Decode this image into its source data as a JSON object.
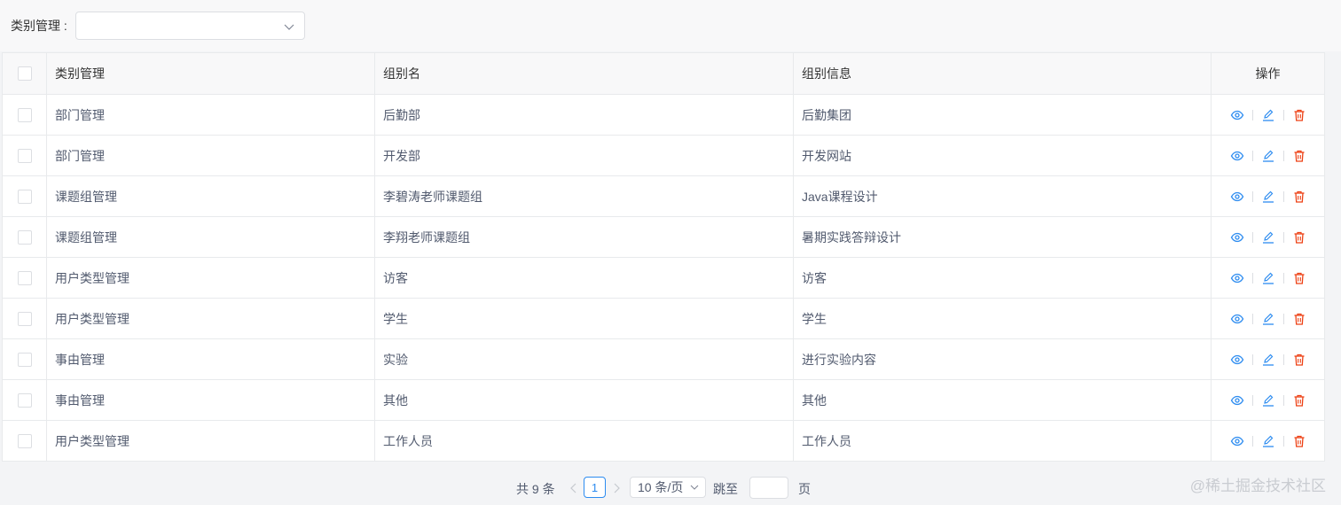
{
  "filter": {
    "label": "类别管理 :",
    "select_value": ""
  },
  "table": {
    "columns": [
      "类别管理",
      "组别名",
      "组别信息",
      "操作"
    ],
    "rows": [
      [
        "部门管理",
        "后勤部",
        "后勤集团"
      ],
      [
        "部门管理",
        "开发部",
        "开发网站"
      ],
      [
        "课题组管理",
        "李碧涛老师课题组",
        "Java课程设计"
      ],
      [
        "课题组管理",
        "李翔老师课题组",
        "暑期实践答辩设计"
      ],
      [
        "用户类型管理",
        "访客",
        "访客"
      ],
      [
        "用户类型管理",
        "学生",
        "学生"
      ],
      [
        "事由管理",
        "实验",
        "进行实验内容"
      ],
      [
        "事由管理",
        "其他",
        "其他"
      ],
      [
        "用户类型管理",
        "工作人员",
        "工作人员"
      ]
    ],
    "row_actions": [
      "eye-icon",
      "edit-icon",
      "trash-icon"
    ]
  },
  "pagination": {
    "total": "共 9 条",
    "current_page": "1",
    "page_size": "10 条/页",
    "jump_label": "跳至",
    "jump_value": "",
    "page_label": "页"
  },
  "watermark": "@稀土掘金技术社区",
  "colors": {
    "view": "#2d8cf0",
    "edit": "#2d8cf0",
    "delete": "#ed4014",
    "border": "#e8eaec",
    "header_bg": "#f8f8f9"
  }
}
